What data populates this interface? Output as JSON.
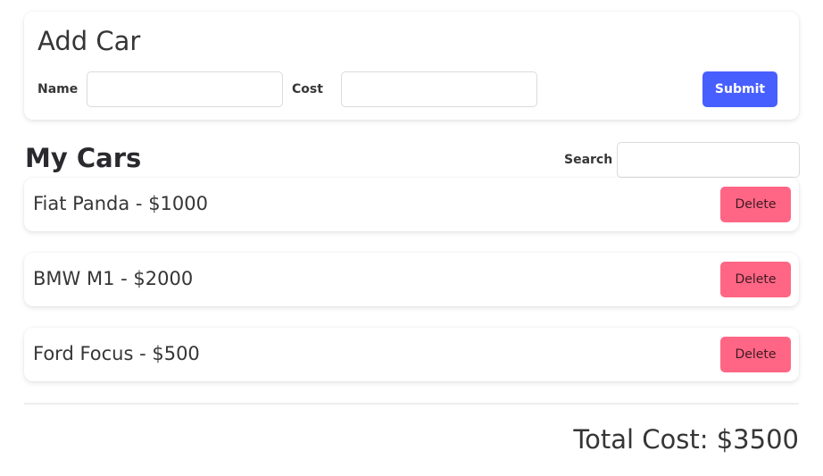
{
  "add_car": {
    "title": "Add Car",
    "name_label": "Name",
    "name_value": "",
    "cost_label": "Cost",
    "cost_value": "",
    "submit_label": "Submit"
  },
  "my_cars": {
    "title": "My Cars",
    "search_label": "Search",
    "search_value": "",
    "delete_label": "Delete",
    "items": [
      {
        "text": "Fiat Panda - $1000"
      },
      {
        "text": "BMW M1 - $2000"
      },
      {
        "text": "Ford Focus - $500"
      }
    ]
  },
  "total": "Total Cost: $3500",
  "colors": {
    "submit": "#485fff",
    "delete": "#ff6685"
  }
}
